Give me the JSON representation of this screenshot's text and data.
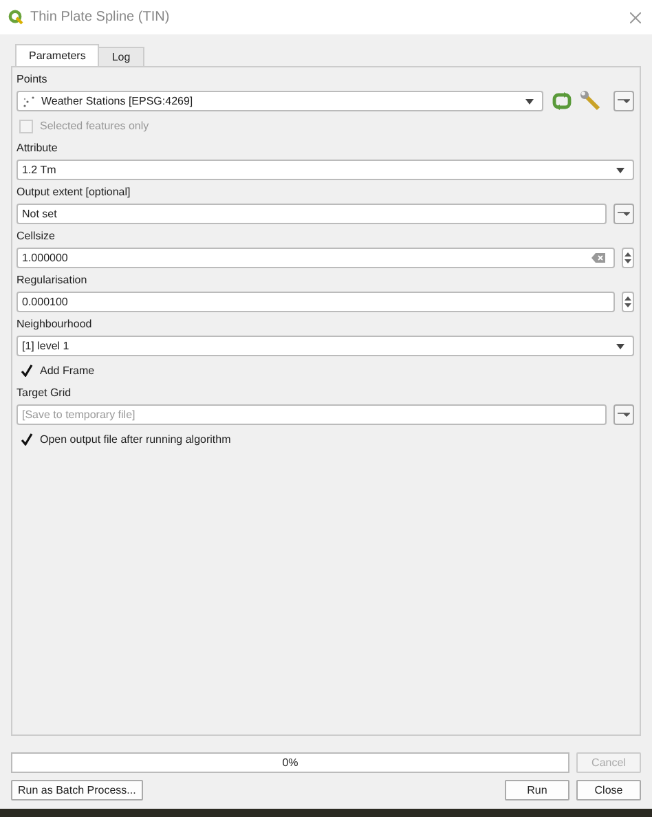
{
  "window": {
    "title": "Thin Plate Spline (TIN)"
  },
  "tabs": [
    {
      "label": "Parameters",
      "selected": true
    },
    {
      "label": "Log",
      "selected": false
    }
  ],
  "parameters": [
    {
      "kind": "layer",
      "label": "Points",
      "value": "Weather Stations [EPSG:4269]"
    },
    {
      "kind": "checkbox",
      "label": "Selected features only",
      "checked": false,
      "disabled": true
    },
    {
      "kind": "combo",
      "label": "Attribute",
      "value": "1.2 Tm"
    },
    {
      "kind": "extent",
      "label": "Output extent [optional]",
      "value": "Not set"
    },
    {
      "kind": "number",
      "label": "Cellsize",
      "value": "1.000000",
      "clear_button": true
    },
    {
      "kind": "number",
      "label": "Regularisation",
      "value": "0.000100",
      "clear_button": false
    },
    {
      "kind": "combo",
      "label": "Neighbourhood",
      "value": "[1] level 1"
    },
    {
      "kind": "checkbox",
      "label": "Add Frame",
      "checked": true,
      "disabled": false
    },
    {
      "kind": "file",
      "label": "Target Grid",
      "placeholder": "[Save to temporary file]"
    },
    {
      "kind": "checkbox",
      "label": "Open output file after running algorithm",
      "checked": true,
      "disabled": false
    }
  ],
  "progress": {
    "level": 0,
    "reading": "0%"
  },
  "cancel_button": {
    "label": "Cancel",
    "disabled": true
  },
  "batch_button": "Run as Batch Process...",
  "run_button": "Run",
  "close_button": "Close"
}
